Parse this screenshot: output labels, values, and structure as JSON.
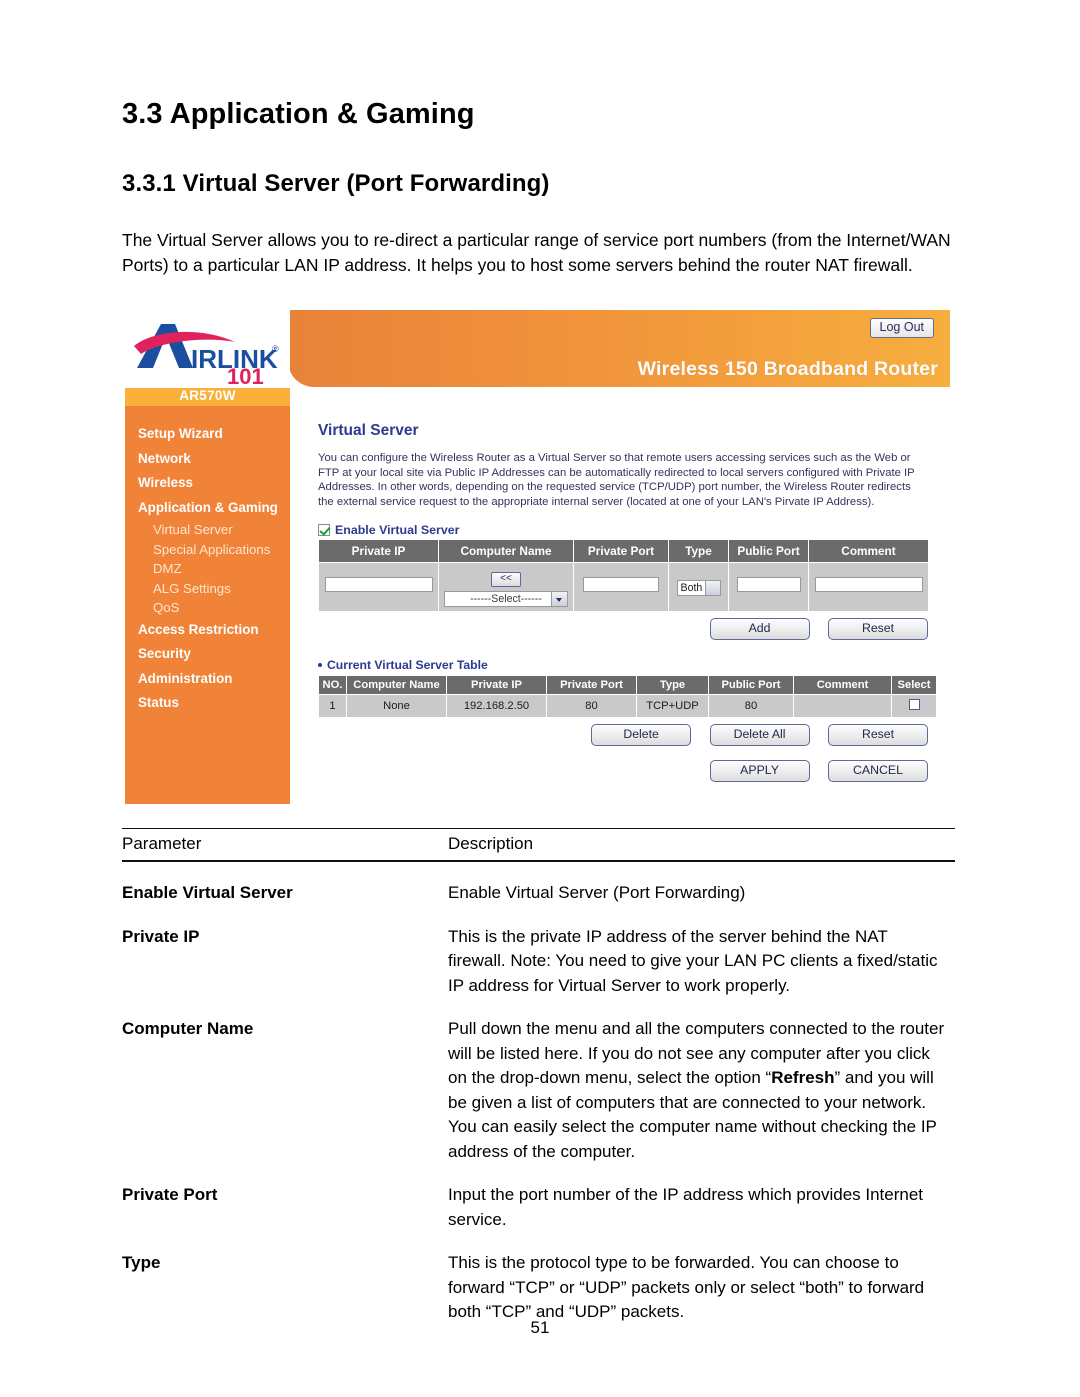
{
  "document": {
    "section_title": "3.3 Application & Gaming",
    "subsection_title": "3.3.1 Virtual Server (Port Forwarding)",
    "intro_paragraph": "The Virtual Server allows you to re-direct a particular range of service port numbers (from the Internet/WAN Ports) to a particular LAN IP address. It helps you to host some servers behind the router NAT firewall.",
    "page_number": "51"
  },
  "router_ui": {
    "brand": {
      "logo_main": "AIRLINK",
      "logo_sub": "101",
      "registered_mark": "®"
    },
    "header": {
      "product_title": "Wireless 150 Broadband Router",
      "logout_label": "Log Out",
      "model_badge": "AR570W",
      "gradient_start": "#e8833a",
      "gradient_end": "#f6ae3e"
    },
    "sidebar": {
      "background": "#f08337",
      "items": [
        {
          "label": "Setup Wizard",
          "level": "top"
        },
        {
          "label": "Network",
          "level": "top"
        },
        {
          "label": "Wireless",
          "level": "top"
        },
        {
          "label": "Application & Gaming",
          "level": "top"
        },
        {
          "label": "Virtual Server",
          "level": "sub"
        },
        {
          "label": "Special Applications",
          "level": "sub"
        },
        {
          "label": "DMZ",
          "level": "sub"
        },
        {
          "label": "ALG Settings",
          "level": "sub"
        },
        {
          "label": "QoS",
          "level": "sub"
        },
        {
          "label": "Access Restriction",
          "level": "top"
        },
        {
          "label": "Security",
          "level": "top"
        },
        {
          "label": "Administration",
          "level": "top"
        },
        {
          "label": "Status",
          "level": "top"
        }
      ]
    },
    "content": {
      "title": "Virtual Server",
      "title_color": "#2d3b8e",
      "description": "You can configure the Wireless Router as a Virtual Server so that remote users accessing services such as the Web or FTP at your local site via Public IP Addresses can be automatically redirected to local servers configured with Private IP Addresses. In other words, depending on the requested service (TCP/UDP) port number, the Wireless Router redirects the external service request to the appropriate internal server (located at one of your LAN's Pirvate IP Address).",
      "enable_checkbox": {
        "label": "Enable Virtual Server",
        "checked": true
      },
      "entry_form": {
        "headers": [
          "Private IP",
          "Computer Name",
          "Private Port",
          "Type",
          "Public Port",
          "Comment"
        ],
        "values": {
          "private_ip": "",
          "computer_name_select": "------Select------",
          "copy_button": "<<",
          "private_port": "",
          "type": "Both",
          "public_port": "",
          "comment": ""
        },
        "buttons": [
          "Add",
          "Reset"
        ]
      },
      "current_table": {
        "caption": "Current Virtual Server Table",
        "headers": [
          "NO.",
          "Computer Name",
          "Private IP",
          "Private Port",
          "Type",
          "Public Port",
          "Comment",
          "Select"
        ],
        "rows": [
          {
            "no": "1",
            "computer_name": "None",
            "private_ip": "192.168.2.50",
            "private_port": "80",
            "type": "TCP+UDP",
            "public_port": "80",
            "comment": "",
            "selected": false
          }
        ],
        "buttons": [
          "Delete",
          "Delete All",
          "Reset"
        ]
      },
      "footer_buttons": [
        "APPLY",
        "CANCEL"
      ]
    }
  },
  "parameter_table": {
    "header": {
      "parameter": "Parameter",
      "description": "Description"
    },
    "rows": [
      {
        "parameter": "Enable Virtual Server",
        "description": "Enable Virtual Server (Port Forwarding)"
      },
      {
        "parameter": "Private IP",
        "description": "This is the private IP address of the server behind the NAT firewall. Note: You need to give your LAN PC clients a fixed/static IP address for Virtual Server to work properly."
      },
      {
        "parameter": "Computer Name",
        "description_prefix": "Pull down the menu and all the computers connected to the router will be listed here. If you do not see any computer after you click on the drop-down menu, select the option “",
        "description_bold": "Refresh",
        "description_suffix": "” and you will be given a list of computers that are connected to your network. You can easily select the computer name without checking the IP address of the computer."
      },
      {
        "parameter": "Private Port",
        "description": "Input the port number of the IP address which provides Internet service."
      },
      {
        "parameter": "Type",
        "description": "This is the protocol type to be forwarded. You can choose to forward “TCP” or “UDP” packets only or select “both” to forward both “TCP” and “UDP” packets."
      }
    ]
  }
}
